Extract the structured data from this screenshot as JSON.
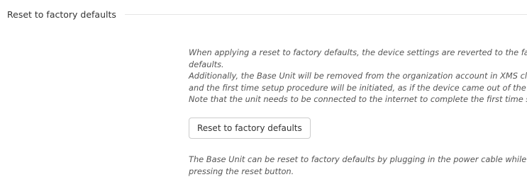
{
  "section": {
    "title": "Reset to factory defaults"
  },
  "description": {
    "lines": [
      "When applying a reset to factory defaults, the device settings are reverted to the factory",
      "defaults.",
      "Additionally, the Base Unit will be removed from the organization account in XMS cloud",
      "and the first time setup procedure will be initiated, as if the device came out of the box.",
      "Note that the unit needs to be connected to the internet to complete the first time setup."
    ]
  },
  "reset_button": {
    "label": "Reset to factory defaults"
  },
  "note": {
    "lines": [
      "The Base Unit can be reset to factory defaults by plugging in the power cable while",
      "pressing the reset button."
    ]
  }
}
